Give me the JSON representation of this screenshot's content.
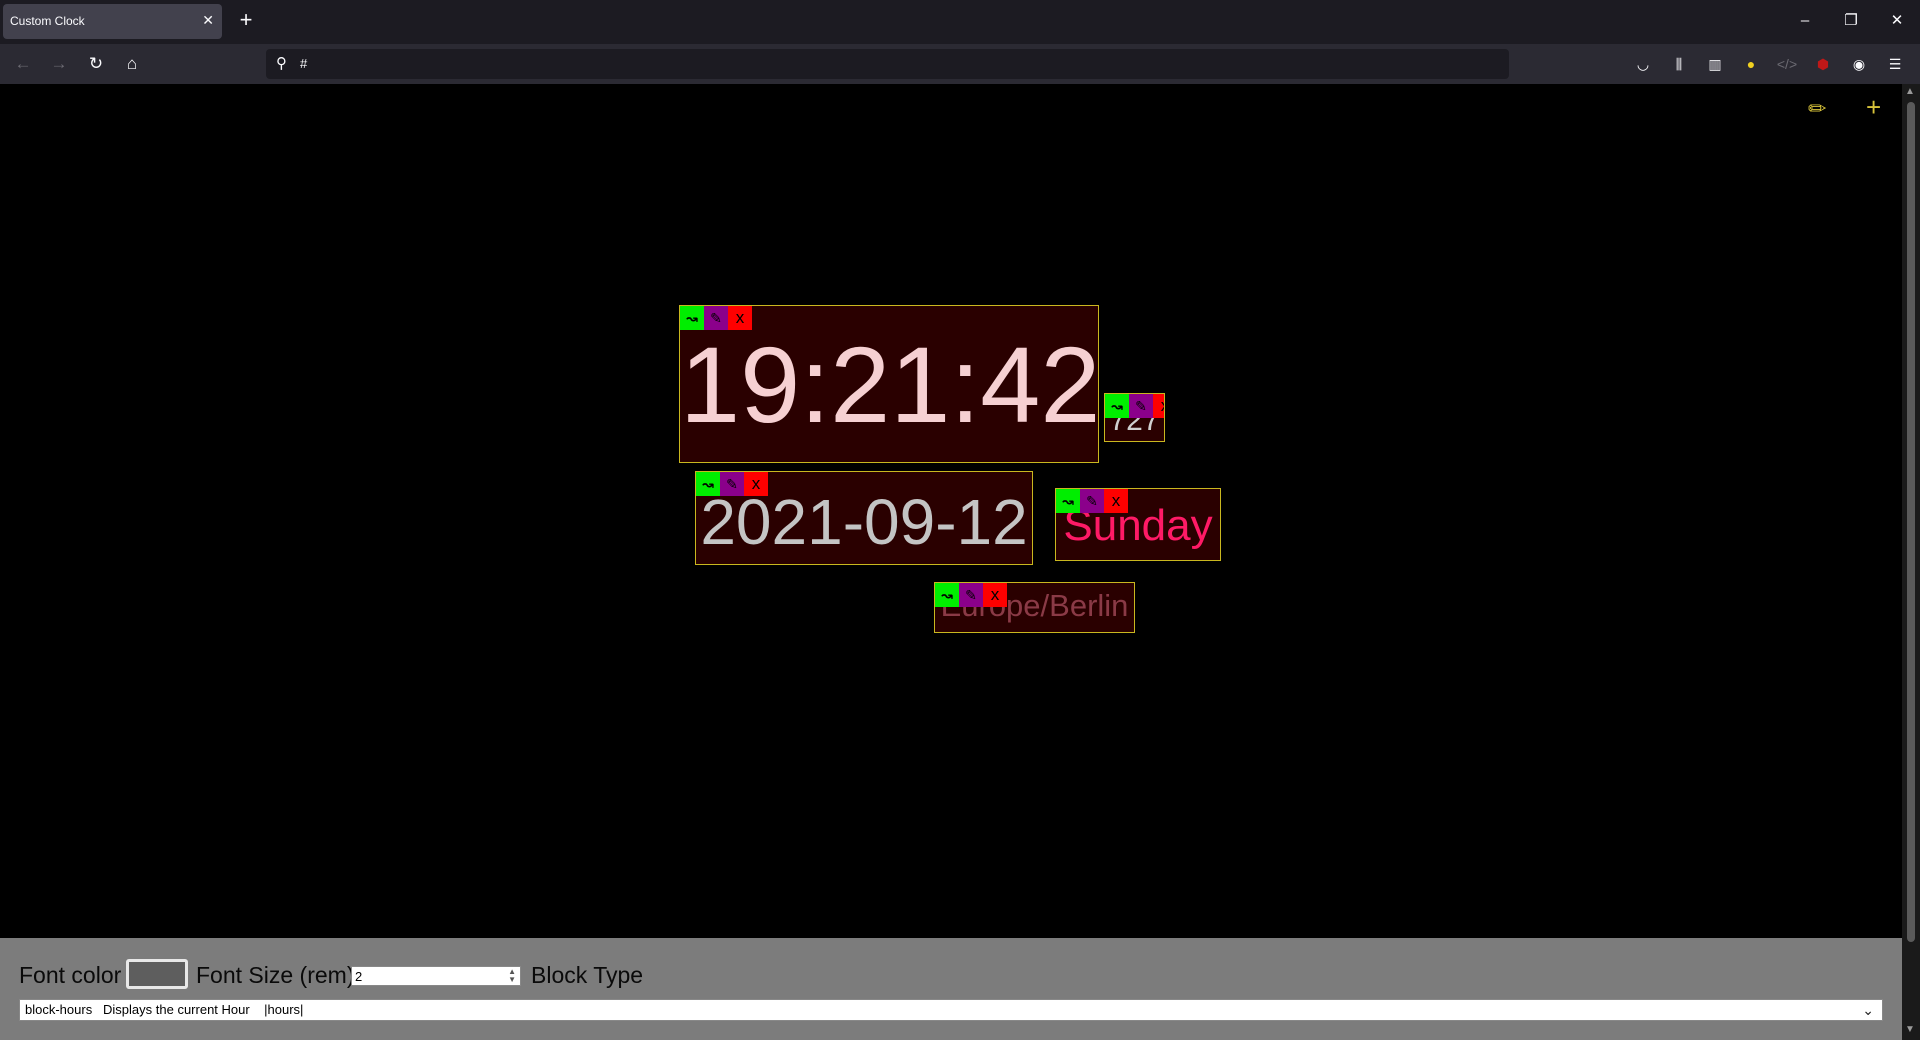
{
  "browser": {
    "tab_title": "Custom Clock",
    "tab_close": "✕",
    "new_tab": "+",
    "url": "#"
  },
  "window_controls": {
    "minimize": "–",
    "restore": "❐",
    "close": "✕"
  },
  "page_controls": {
    "edit_icon": "✏",
    "add_icon": "+"
  },
  "blocks": [
    {
      "id": "time",
      "text": "19:21:42",
      "color": "#f6d0d2"
    },
    {
      "id": "small",
      "text": "727",
      "color": "#cfcfcf"
    },
    {
      "id": "date",
      "text": "2021-09-12",
      "color": "#c4c4c4"
    },
    {
      "id": "weekday",
      "text": "Sunday",
      "color": "#ff1a66"
    },
    {
      "id": "timezone",
      "text": "Europe/Berlin",
      "color": "#8a3a46"
    }
  ],
  "block_controls": {
    "move": "↝",
    "edit": "✎",
    "delete": "x"
  },
  "editor": {
    "font_color_label": "Font color",
    "font_color_value": "#5e5e5e",
    "font_size_label": "Font Size (rem)",
    "font_size_value": "2",
    "block_type_label": "Block Type",
    "block_type_selected": "block-hours   Displays the current Hour    |hours|"
  }
}
